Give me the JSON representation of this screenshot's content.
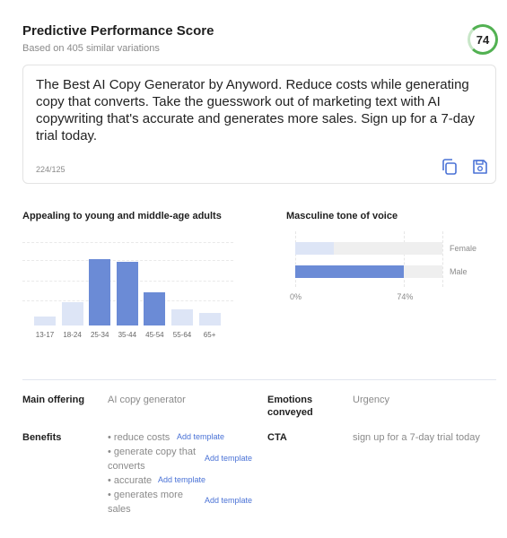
{
  "header": {
    "title": "Predictive Performance Score",
    "subtitle": "Based on 405 similar variations",
    "score": "74"
  },
  "copy": {
    "text": "The Best AI Copy Generator by Anyword. Reduce costs while generating copy that converts. Take the guesswork out of marketing text with AI copywriting that's accurate and generates more sales. Sign up for a 7-day trial today.",
    "char_count": "224/125",
    "icons": [
      "copy-icon",
      "save-icon"
    ]
  },
  "charts": {
    "age_title": "Appealing to young and middle-age adults",
    "tone_title": "Masculine tone of voice"
  },
  "chart_data": [
    {
      "type": "bar",
      "title": "Appealing to young and middle-age adults",
      "categories": [
        "13-17",
        "18-24",
        "25-34",
        "35-44",
        "45-54",
        "55-64",
        "65+"
      ],
      "values": [
        10,
        26,
        74,
        71,
        37,
        18,
        14
      ],
      "highlighted": [
        false,
        false,
        true,
        true,
        true,
        false,
        false
      ],
      "ylim": [
        0,
        100
      ],
      "colors": {
        "highlight": "#6b8bd6",
        "muted": "#dde5f6"
      }
    },
    {
      "type": "bar",
      "orientation": "horizontal",
      "title": "Masculine tone of voice",
      "categories": [
        "Female",
        "Male"
      ],
      "values": [
        26,
        74
      ],
      "xlim": [
        0,
        100
      ],
      "tick_labels": [
        "0%",
        "74%"
      ],
      "colors": {
        "Female": "#dde5f6",
        "Male": "#6b8bd6",
        "track": "#efefef"
      }
    }
  ],
  "details": {
    "main_offering_label": "Main offering",
    "main_offering_value": "AI copy generator",
    "emotions_label": "Emotions conveyed",
    "emotions_value": "Urgency",
    "benefits_label": "Benefits",
    "benefits": [
      {
        "text": "• reduce costs",
        "action": "Add template"
      },
      {
        "text": "• generate copy that converts",
        "action": "Add template"
      },
      {
        "text": "• accurate",
        "action": "Add template"
      },
      {
        "text": "• generates more sales",
        "action": "Add template"
      }
    ],
    "cta_label": "CTA",
    "cta_value": "sign up for a 7-day trial today"
  }
}
